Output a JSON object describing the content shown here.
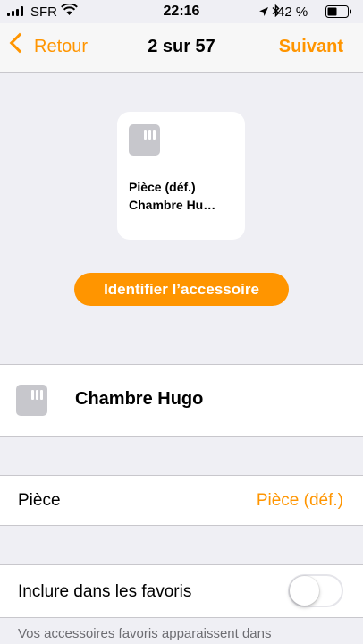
{
  "status_bar": {
    "carrier": "SFR",
    "time": "22:16",
    "battery": "42 %"
  },
  "nav": {
    "back_label": "Retour",
    "title": "2 sur 57",
    "next_label": "Suivant"
  },
  "tile": {
    "room": "Pièce (déf.)",
    "name": "Chambre Hu…"
  },
  "identify_button": "Identifier l’accessoire",
  "accessory_name": "Chambre Hugo",
  "room_row": {
    "label": "Pièce",
    "value": "Pièce (déf.)"
  },
  "favorites_row": {
    "label": "Inclure dans les favoris",
    "enabled": false
  },
  "footer_text": "Vos accessoires favoris apparaissent dans",
  "colors": {
    "accent": "#ff9500",
    "background": "#efeff4",
    "icon_gray": "#c7c7cc"
  }
}
